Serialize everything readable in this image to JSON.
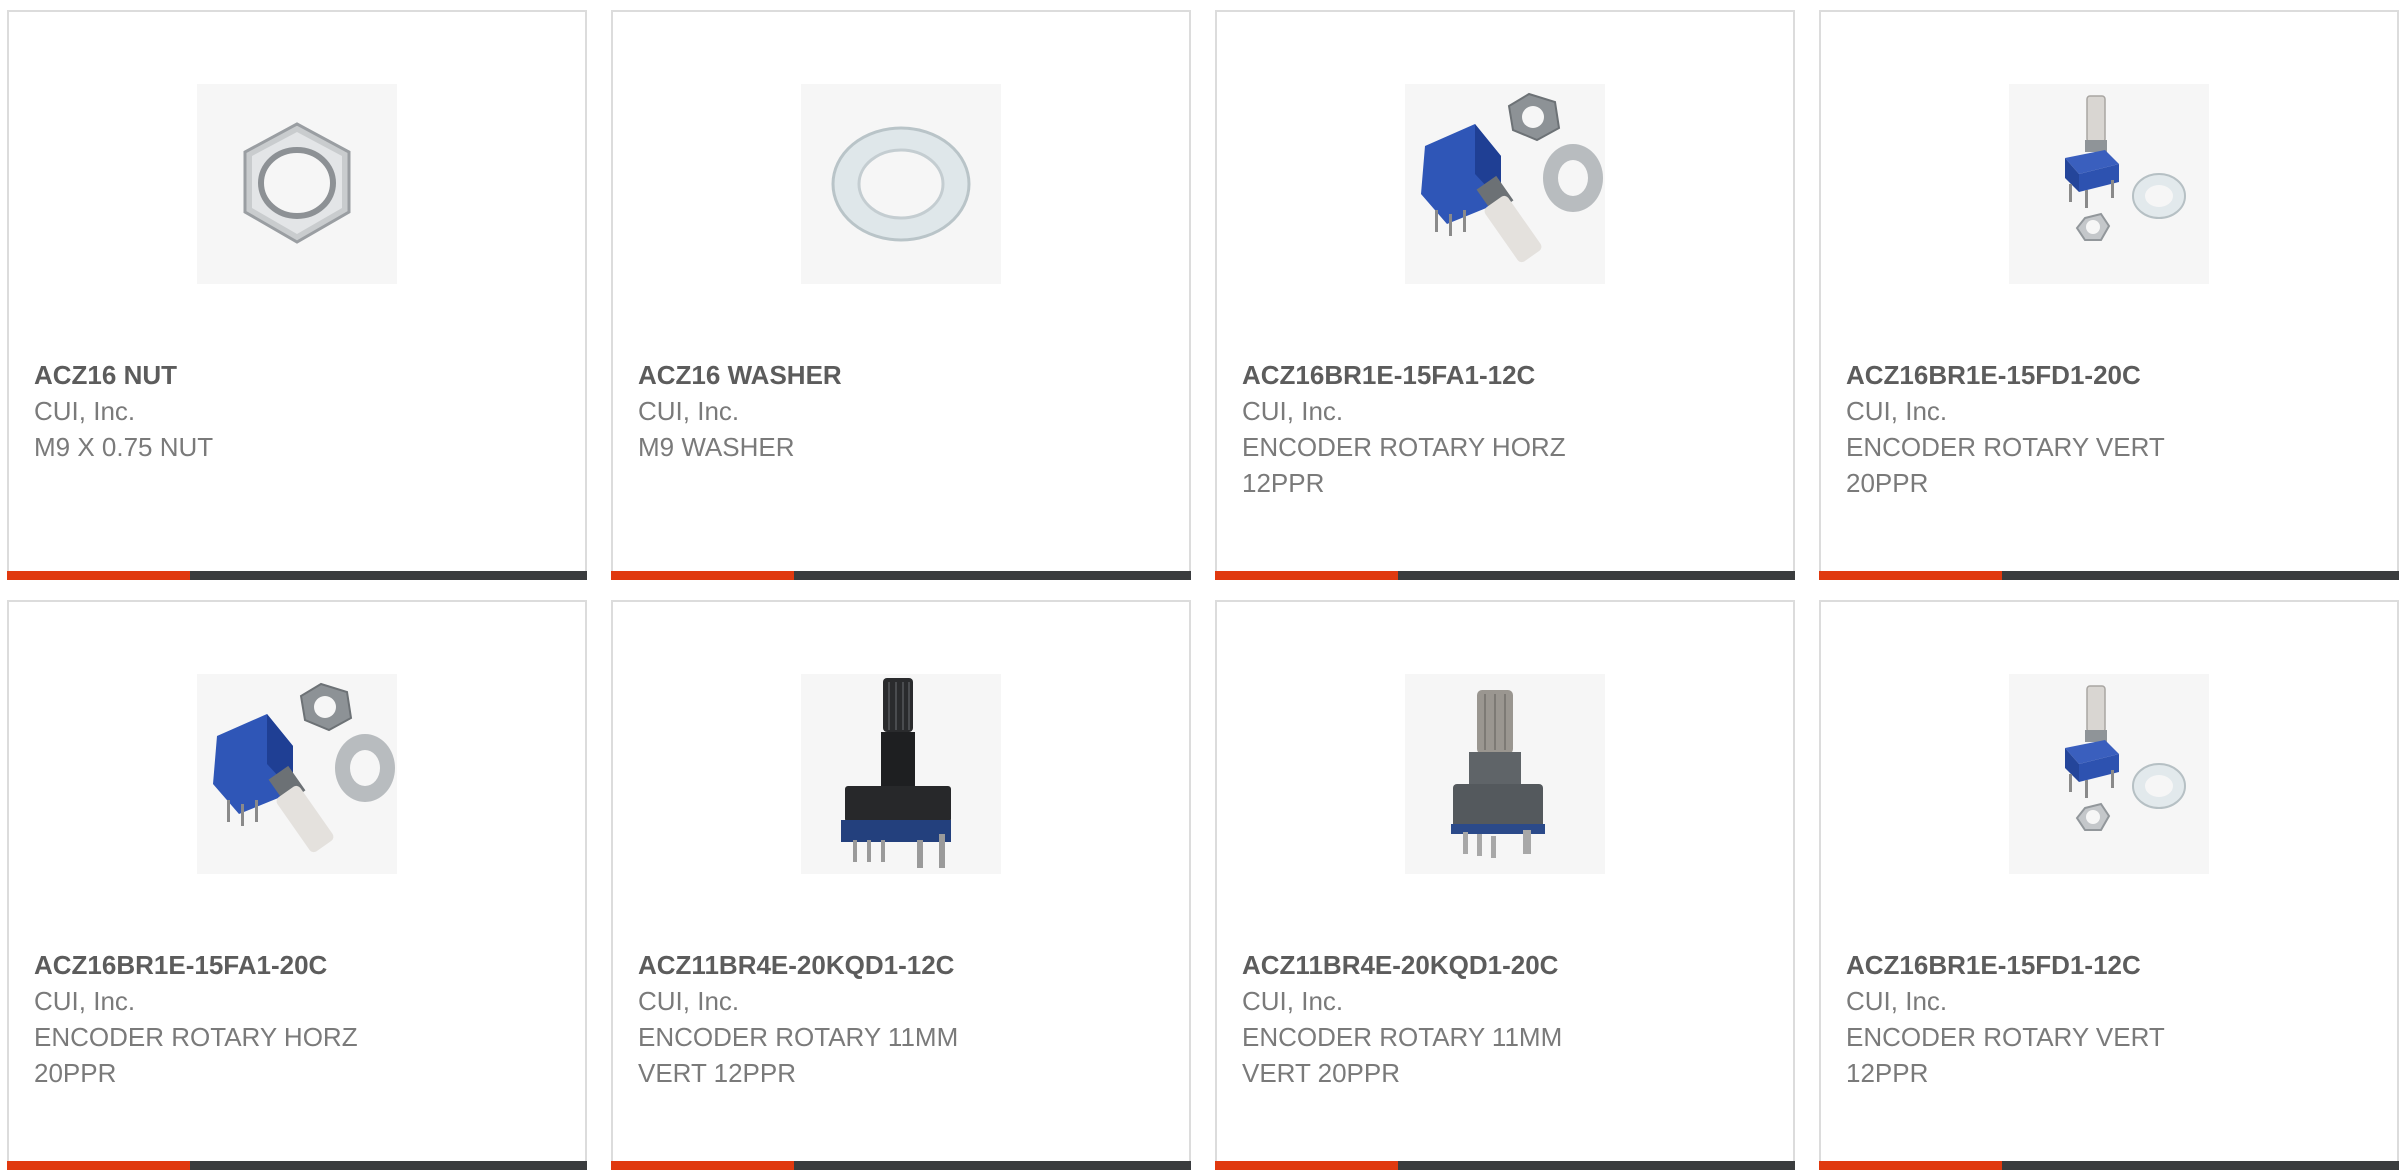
{
  "products": [
    {
      "part": "ACZ16 NUT",
      "manufacturer": "CUI, Inc.",
      "description": "M9 X 0.75 NUT",
      "image": "hex-nut-icon"
    },
    {
      "part": "ACZ16 WASHER",
      "manufacturer": "CUI, Inc.",
      "description": "M9 WASHER",
      "image": "washer-icon"
    },
    {
      "part": "ACZ16BR1E-15FA1-12C",
      "manufacturer": "CUI, Inc.",
      "description": "ENCODER ROTARY HORZ 12PPR",
      "image": "horizontal-encoder-icon"
    },
    {
      "part": "ACZ16BR1E-15FD1-20C",
      "manufacturer": "CUI, Inc.",
      "description": "ENCODER ROTARY VERT 20PPR",
      "image": "vertical-encoder-icon"
    },
    {
      "part": "ACZ16BR1E-15FA1-20C",
      "manufacturer": "CUI, Inc.",
      "description": "ENCODER ROTARY HORZ 20PPR",
      "image": "horizontal-encoder-icon"
    },
    {
      "part": "ACZ11BR4E-20KQD1-12C",
      "manufacturer": "CUI, Inc.",
      "description": "ENCODER ROTARY 11MM VERT 12PPR",
      "image": "black-knurled-encoder-icon"
    },
    {
      "part": "ACZ11BR4E-20KQD1-20C",
      "manufacturer": "CUI, Inc.",
      "description": "ENCODER ROTARY 11MM VERT 20PPR",
      "image": "metal-shaft-encoder-icon"
    },
    {
      "part": "ACZ16BR1E-15FD1-12C",
      "manufacturer": "CUI, Inc.",
      "description": "ENCODER ROTARY VERT 12PPR",
      "image": "vertical-encoder-icon"
    }
  ],
  "colors": {
    "accent": "#e0390f",
    "bar": "#3a3c3e",
    "part_text": "#5c5c5c",
    "body_text": "#7a7a7a",
    "card_border": "#dcdcdc"
  }
}
